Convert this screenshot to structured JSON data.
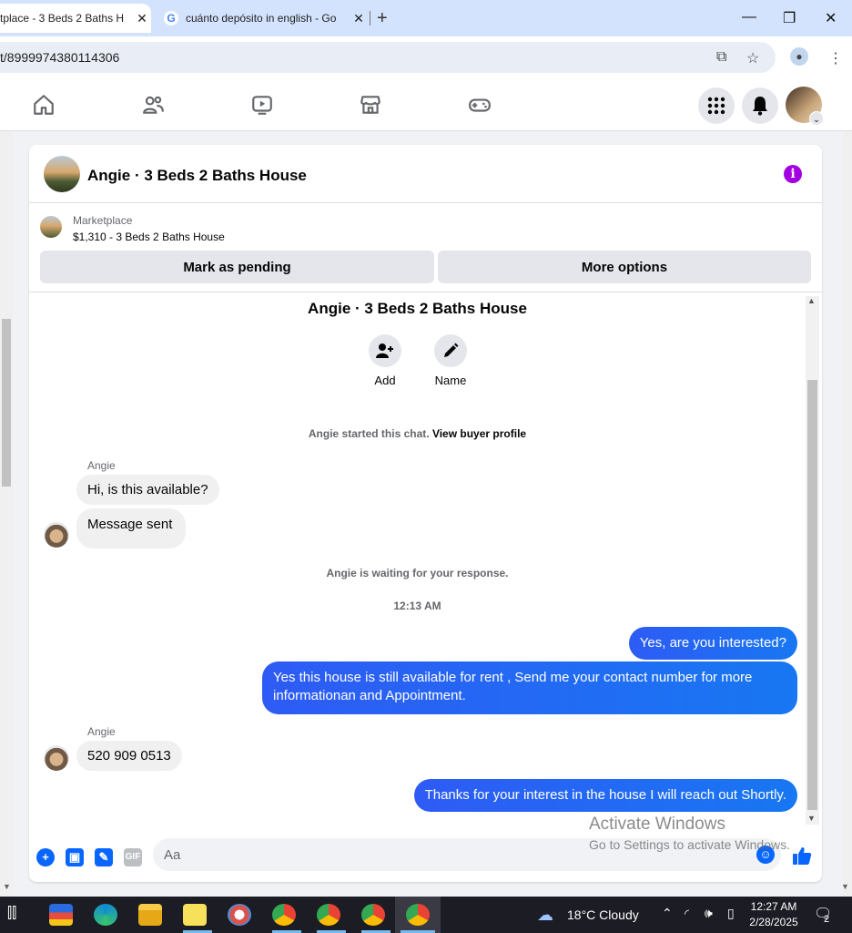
{
  "browser": {
    "tabs": [
      {
        "title": "tplace - 3 Beds 2 Baths H",
        "active": true
      },
      {
        "title": "cuánto depósito in english - Go",
        "active": false
      }
    ],
    "url": "t/8999974380114306"
  },
  "fb_nav": {
    "icons": [
      "home-icon",
      "friends-icon",
      "video-icon",
      "marketplace-icon",
      "gaming-icon"
    ],
    "right_icons": [
      "menu-grid-icon",
      "notifications-bell-icon",
      "profile-avatar"
    ]
  },
  "chat": {
    "header_title": "Angie · 3 Beds 2 Baths House",
    "marketplace_label": "Marketplace",
    "listing": "$1,310 - 3 Beds 2 Baths House",
    "mark_pending": "Mark as pending",
    "more_options": "More options",
    "conv_title": "Angie · 3 Beds 2 Baths House",
    "actions": {
      "add": "Add",
      "name": "Name"
    },
    "started_text": "Angie started this chat.",
    "view_profile": "View buyer profile",
    "messages_1": {
      "sender": "Angie",
      "m1": "Hi, is this available?",
      "m2": "Message sent"
    },
    "waiting_text": "Angie is waiting for your response.",
    "timestamp": "12:13 AM",
    "outgoing_1": "Yes, are you interested?",
    "outgoing_2": "Yes this house is still available for rent , Send me your contact number for more informationan and Appointment.",
    "messages_2": {
      "sender": "Angie",
      "m1": "520 909 0513"
    },
    "outgoing_3": "Thanks for your interest in the house I will reach out Shortly.",
    "composer_placeholder": "Aa",
    "composer_gif": "GIF"
  },
  "watermark": {
    "line1": "Activate Windows",
    "line2": "Go to Settings to activate Windows."
  },
  "taskbar": {
    "weather": "18°C  Cloudy",
    "time": "12:27 AM",
    "date": "2/28/2025",
    "notif_count": "2"
  },
  "colors": {
    "accent": "#0866ff",
    "bubble_out": "#1877f2",
    "info": "#a200e0"
  }
}
